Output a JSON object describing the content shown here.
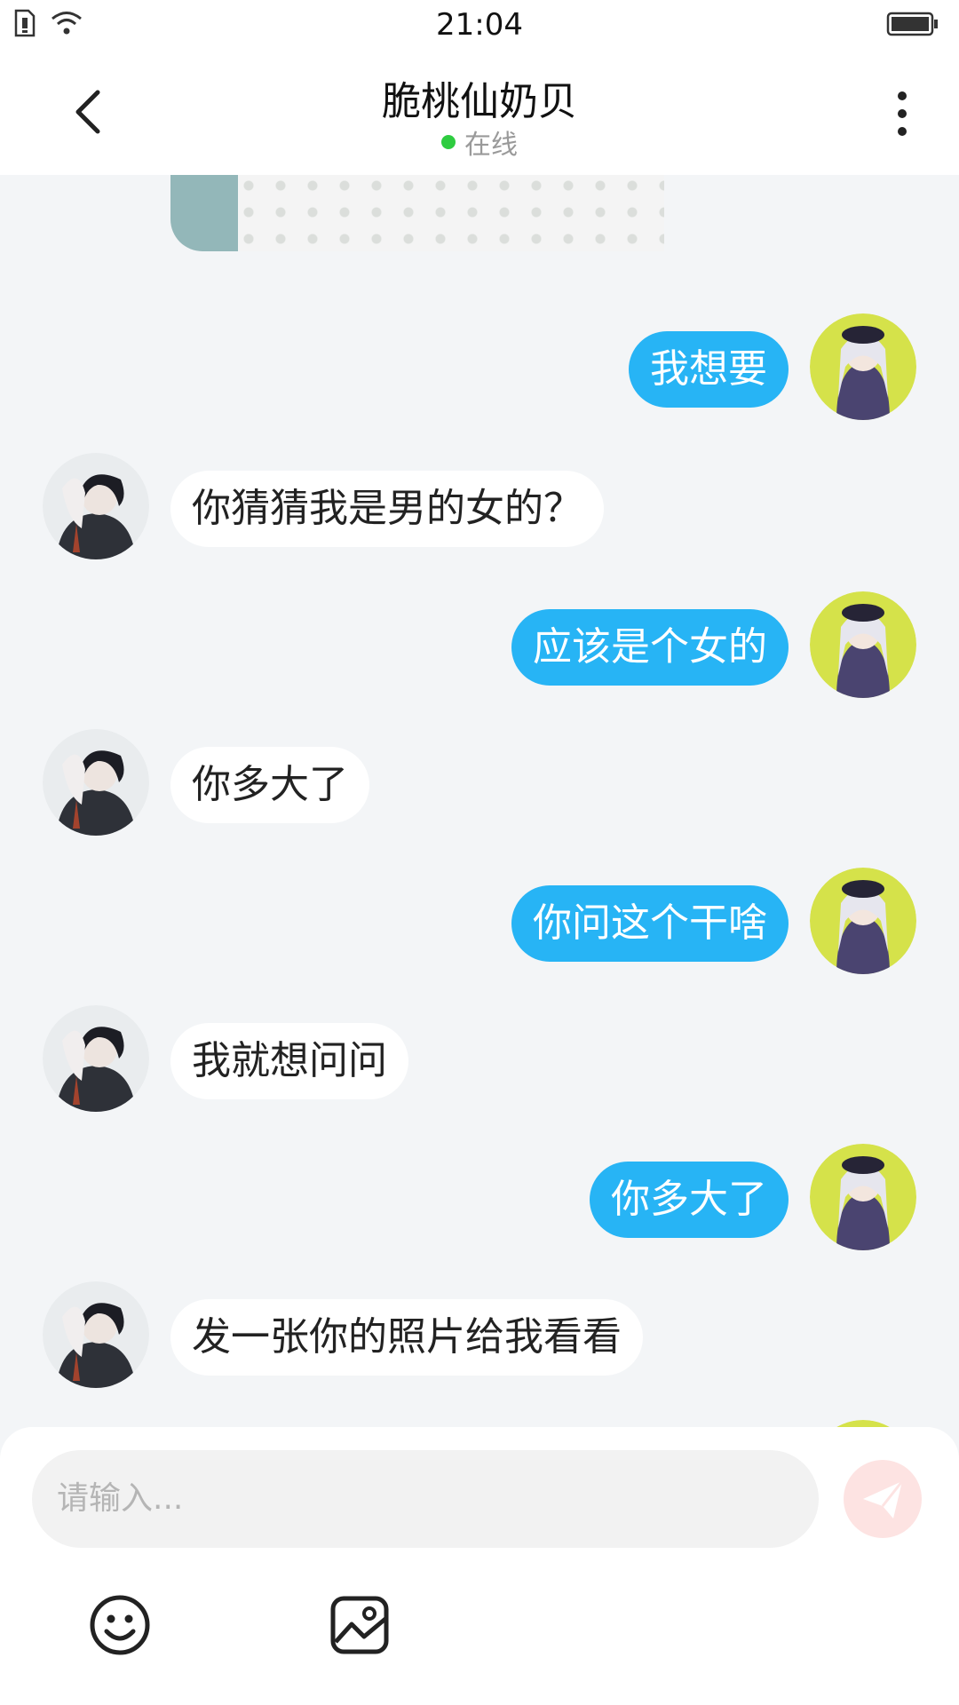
{
  "status_bar": {
    "time": "21:04"
  },
  "header": {
    "title": "脆桃仙奶贝",
    "status": "在线",
    "status_color": "#2ecc40"
  },
  "messages": [
    {
      "side": "mine",
      "text": "我想要"
    },
    {
      "side": "theirs",
      "text": "你猜猜我是男的女的？"
    },
    {
      "side": "mine",
      "text": "应该是个女的"
    },
    {
      "side": "theirs",
      "text": "你多大了"
    },
    {
      "side": "mine",
      "text": "你问这个干啥"
    },
    {
      "side": "theirs",
      "text": "我就想问问"
    },
    {
      "side": "mine",
      "text": "你多大了"
    },
    {
      "side": "theirs",
      "text": "发一张你的照片给我看看"
    }
  ],
  "input": {
    "placeholder": "请输入..."
  },
  "colors": {
    "my_bubble": "#27b4f5",
    "their_bubble": "#ffffff",
    "background": "#f3f5f7",
    "send_button": "#fde3e2"
  },
  "icons": [
    "back-icon",
    "more-icon",
    "send-icon",
    "emoji-icon",
    "image-icon",
    "signal-icon",
    "wifi-icon",
    "battery-icon"
  ]
}
